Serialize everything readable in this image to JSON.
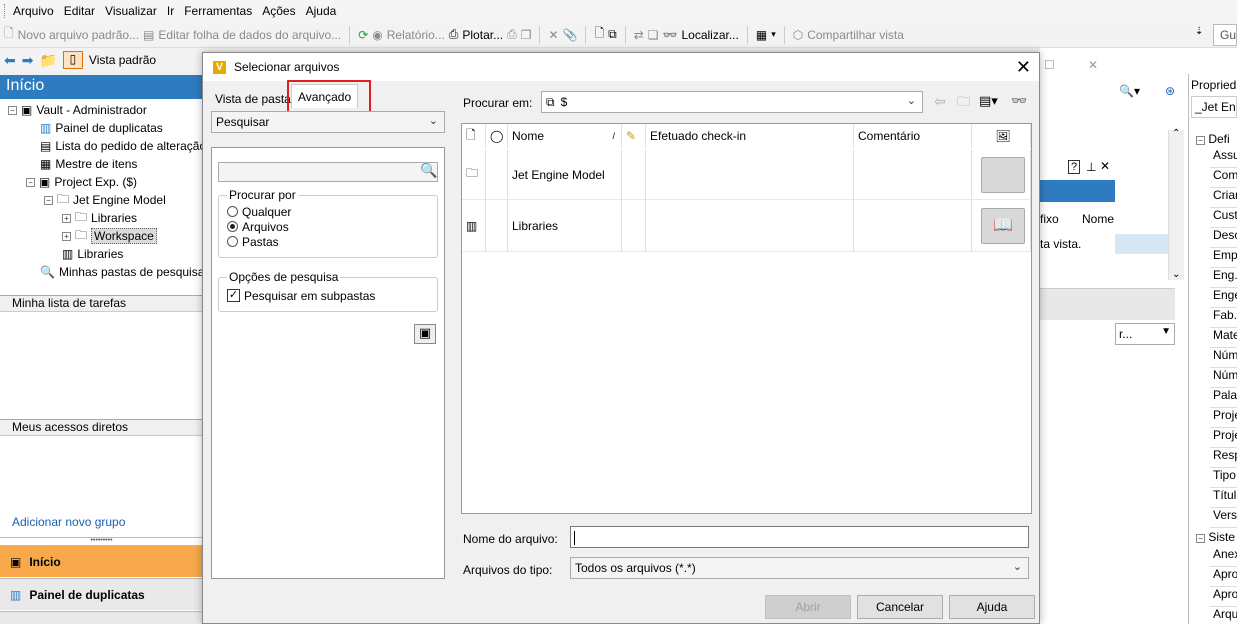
{
  "menu": [
    "Arquivo",
    "Editar",
    "Visualizar",
    "Ir",
    "Ferramentas",
    "Ações",
    "Ajuda"
  ],
  "toolbar1": {
    "novo": "Novo arquivo padrão...",
    "editar": "Editar folha de dados do arquivo...",
    "relatorio": "Relatório...",
    "plotar": "Plotar...",
    "localizar": "Localizar...",
    "compartilhar": "Compartilhar vista",
    "gu": "Gu"
  },
  "toolbar2": {
    "vista": "Vista padrão"
  },
  "leftnav": {
    "title": "Início",
    "tree": [
      "Vault - Administrador",
      "Painel de duplicatas",
      "Lista do pedido de alteração",
      "Mestre de itens",
      "Project Exp. ($)",
      "Jet Engine Model",
      "Libraries",
      "Workspace",
      "Libraries",
      "Minhas pastas de pesquisa"
    ],
    "sections": [
      "Minha lista de tarefas",
      "Meus acessos diretos"
    ],
    "add_group": "Adicionar novo grupo",
    "nav_buttons": [
      "Início",
      "Painel de duplicatas"
    ]
  },
  "background_right": {
    "props_title": "Propried",
    "jet": "_Jet Eng",
    "cols": [
      "fixo",
      "Nome"
    ],
    "hint": "ta vista.",
    "def": "Defi",
    "sist": "Siste",
    "props": [
      "Assu",
      "Com",
      "Criar",
      "Cust",
      "Desc",
      "Emp",
      "Eng.",
      "Enge",
      "Fab.",
      "Mate",
      "Núm",
      "Núm",
      "Palav",
      "Proje",
      "Proje",
      "Resp",
      "Tipo",
      "Títul",
      "Versa"
    ],
    "sist_props": [
      "Anex",
      "Apro",
      "Apro",
      "Arqu"
    ]
  },
  "dialog": {
    "title": "Selecionar arquivos",
    "tabs": [
      "Vista de pasta",
      "Avançado"
    ],
    "search_combo": "Pesquisar",
    "search_input_value": "",
    "procurar_por": {
      "legend": "Procurar por",
      "options": [
        "Qualquer",
        "Arquivos",
        "Pastas"
      ],
      "selected": "Arquivos"
    },
    "opcoes": {
      "legend": "Opções de pesquisa",
      "subpastas": "Pesquisar em subpastas",
      "subpastas_checked": true
    },
    "procurar_em_label": "Procurar em:",
    "procurar_em_value": "$",
    "columns": [
      "Nome",
      "Efetuado check-in",
      "Comentário"
    ],
    "rows": [
      {
        "name": "Jet Engine Model"
      },
      {
        "name": "Libraries"
      }
    ],
    "nome_label": "Nome do arquivo:",
    "nome_value": "",
    "tipo_label": "Arquivos do tipo:",
    "tipo_value": "Todos os arquivos (*.*)",
    "buttons": {
      "abrir": "Abrir",
      "cancelar": "Cancelar",
      "ajuda": "Ajuda"
    }
  },
  "colors": {
    "accent": "#2f7bc2",
    "highlight": "#e02020",
    "nav_active": "#f7a94b"
  }
}
